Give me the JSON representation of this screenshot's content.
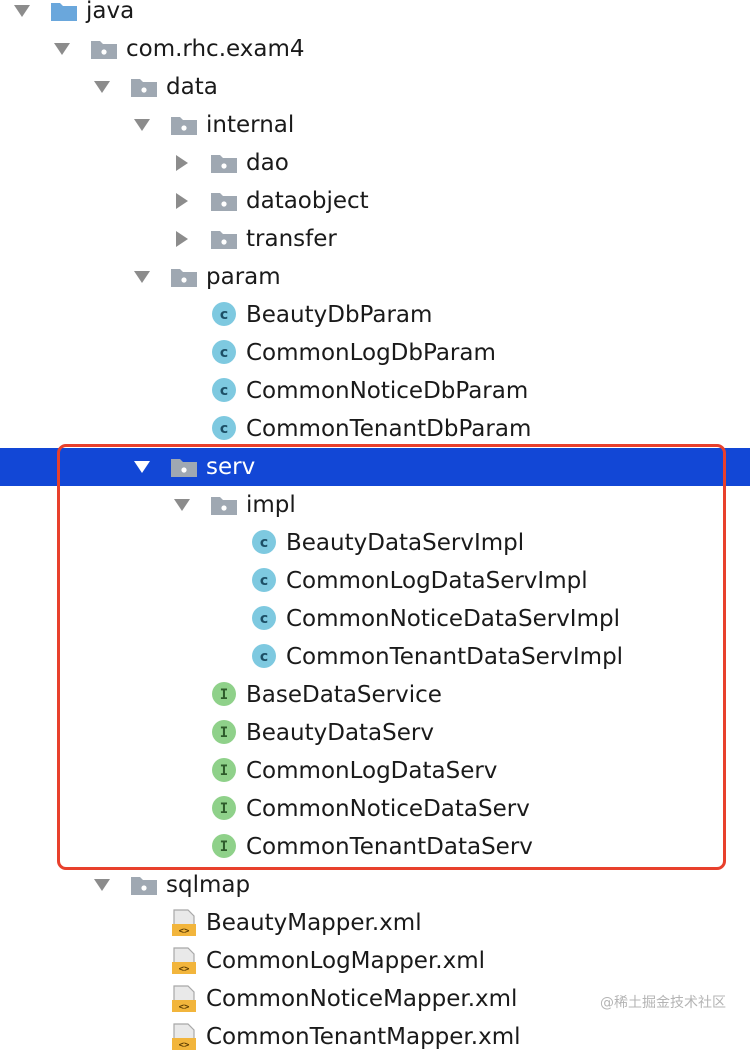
{
  "tree": {
    "rows": [
      {
        "label": "java",
        "depth": 0,
        "type": "folder-source",
        "expand": "expanded",
        "icon": "folder-icon"
      },
      {
        "label": "com.rhc.exam4",
        "depth": 1,
        "type": "package",
        "expand": "expanded",
        "icon": "package-folder-icon"
      },
      {
        "label": "data",
        "depth": 2,
        "type": "package",
        "expand": "expanded",
        "icon": "package-folder-icon"
      },
      {
        "label": "internal",
        "depth": 3,
        "type": "package",
        "expand": "expanded",
        "icon": "package-folder-icon"
      },
      {
        "label": "dao",
        "depth": 4,
        "type": "package",
        "expand": "collapsed",
        "icon": "package-folder-icon"
      },
      {
        "label": "dataobject",
        "depth": 4,
        "type": "package",
        "expand": "collapsed",
        "icon": "package-folder-icon"
      },
      {
        "label": "transfer",
        "depth": 4,
        "type": "package",
        "expand": "collapsed",
        "icon": "package-folder-icon"
      },
      {
        "label": "param",
        "depth": 3,
        "type": "package",
        "expand": "expanded",
        "icon": "package-folder-icon"
      },
      {
        "label": "BeautyDbParam",
        "depth": 4,
        "type": "class",
        "expand": "none",
        "icon": "class-icon"
      },
      {
        "label": "CommonLogDbParam",
        "depth": 4,
        "type": "class",
        "expand": "none",
        "icon": "class-icon"
      },
      {
        "label": "CommonNoticeDbParam",
        "depth": 4,
        "type": "class",
        "expand": "none",
        "icon": "class-icon"
      },
      {
        "label": "CommonTenantDbParam",
        "depth": 4,
        "type": "class",
        "expand": "none",
        "icon": "class-icon"
      },
      {
        "label": "serv",
        "depth": 3,
        "type": "package",
        "expand": "expanded",
        "icon": "package-folder-icon",
        "selected": true
      },
      {
        "label": "impl",
        "depth": 4,
        "type": "package",
        "expand": "expanded",
        "icon": "package-folder-icon"
      },
      {
        "label": "BeautyDataServImpl",
        "depth": 5,
        "type": "class",
        "expand": "none",
        "icon": "class-icon"
      },
      {
        "label": "CommonLogDataServImpl",
        "depth": 5,
        "type": "class",
        "expand": "none",
        "icon": "class-icon"
      },
      {
        "label": "CommonNoticeDataServImpl",
        "depth": 5,
        "type": "class",
        "expand": "none",
        "icon": "class-icon"
      },
      {
        "label": "CommonTenantDataServImpl",
        "depth": 5,
        "type": "class",
        "expand": "none",
        "icon": "class-icon"
      },
      {
        "label": "BaseDataService",
        "depth": 4,
        "type": "interface",
        "expand": "none",
        "icon": "interface-icon"
      },
      {
        "label": "BeautyDataServ",
        "depth": 4,
        "type": "interface",
        "expand": "none",
        "icon": "interface-icon"
      },
      {
        "label": "CommonLogDataServ",
        "depth": 4,
        "type": "interface",
        "expand": "none",
        "icon": "interface-icon"
      },
      {
        "label": "CommonNoticeDataServ",
        "depth": 4,
        "type": "interface",
        "expand": "none",
        "icon": "interface-icon"
      },
      {
        "label": "CommonTenantDataServ",
        "depth": 4,
        "type": "interface",
        "expand": "none",
        "icon": "interface-icon"
      },
      {
        "label": "sqlmap",
        "depth": 2,
        "type": "package",
        "expand": "expanded",
        "icon": "package-folder-icon"
      },
      {
        "label": "BeautyMapper.xml",
        "depth": 3,
        "type": "xml",
        "expand": "none",
        "icon": "xml-file-icon"
      },
      {
        "label": "CommonLogMapper.xml",
        "depth": 3,
        "type": "xml",
        "expand": "none",
        "icon": "xml-file-icon"
      },
      {
        "label": "CommonNoticeMapper.xml",
        "depth": 3,
        "type": "xml",
        "expand": "none",
        "icon": "xml-file-icon"
      },
      {
        "label": "CommonTenantMapper.xml",
        "depth": 3,
        "type": "xml",
        "expand": "none",
        "icon": "xml-file-icon"
      }
    ]
  },
  "colors": {
    "selection": "#1247d6",
    "highlight_border": "#e8402c",
    "class_badge": "#7ec9e0",
    "interface_badge": "#8fd18a",
    "folder_grey": "#9fa8b2",
    "source_folder": "#6aa7dc"
  },
  "watermark": "@稀土掘金技术社区"
}
